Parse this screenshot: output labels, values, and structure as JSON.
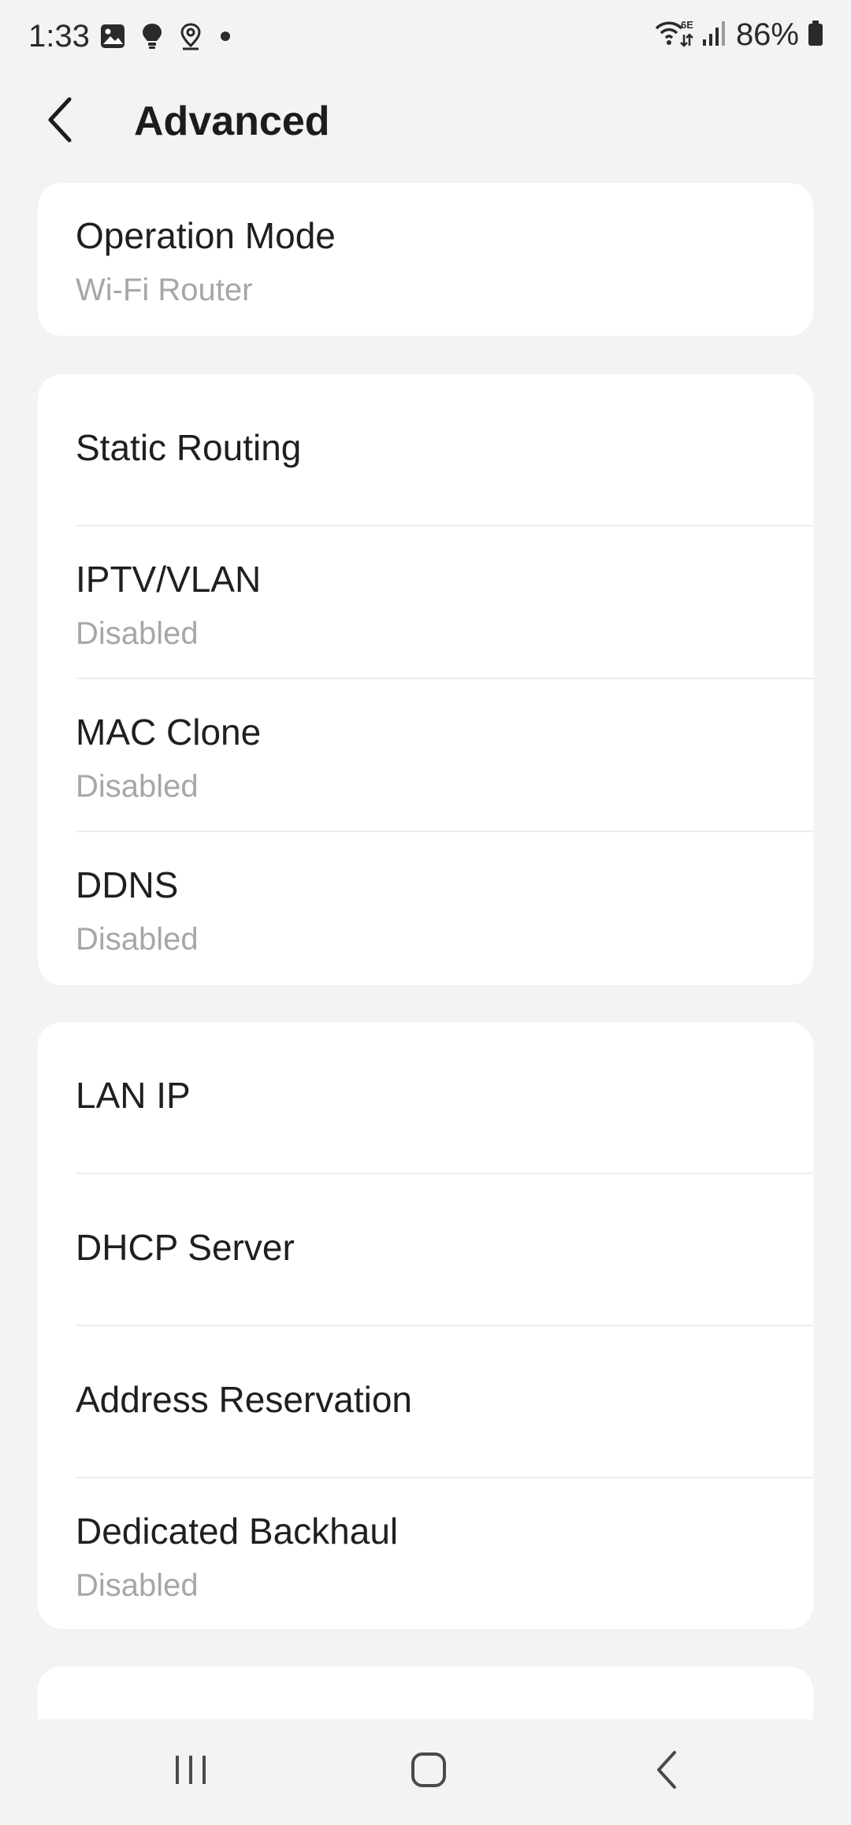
{
  "status_bar": {
    "time": "1:33",
    "battery": "86%",
    "left_icons": [
      "gallery-icon",
      "bulb-icon",
      "location-icon",
      "dot-icon"
    ],
    "right_icons": [
      "wifi-6e-icon",
      "signal-icon",
      "battery-icon"
    ]
  },
  "header": {
    "title": "Advanced",
    "back_icon": "back-chevron-icon"
  },
  "cards": [
    {
      "items": [
        {
          "title": "Operation Mode",
          "subtitle": "Wi-Fi Router"
        }
      ]
    },
    {
      "items": [
        {
          "title": "Static Routing"
        },
        {
          "title": "IPTV/VLAN",
          "subtitle": "Disabled"
        },
        {
          "title": "MAC Clone",
          "subtitle": "Disabled"
        },
        {
          "title": "DDNS",
          "subtitle": "Disabled"
        }
      ]
    },
    {
      "items": [
        {
          "title": "LAN IP"
        },
        {
          "title": "DHCP Server"
        },
        {
          "title": "Address Reservation"
        },
        {
          "title": "Dedicated Backhaul",
          "subtitle": "Disabled"
        }
      ]
    }
  ],
  "nav_bar": {
    "recents_icon": "recents-icon",
    "home_icon": "home-icon",
    "back_icon": "nav-back-icon"
  },
  "colors": {
    "background": "#f3f3f6",
    "card": "#ffffff",
    "text_primary": "#1f1f1f",
    "text_secondary": "#a6a6ab",
    "divider": "#ececef"
  }
}
